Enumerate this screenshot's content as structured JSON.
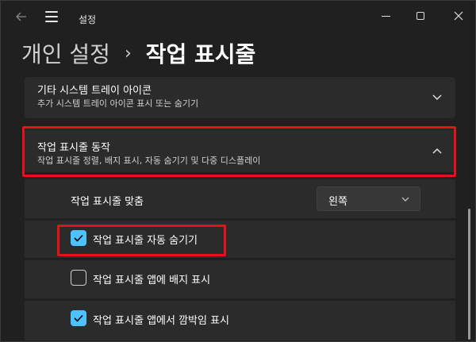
{
  "window": {
    "app_title": "설정",
    "controls": {
      "minimize": "minimize-icon",
      "maximize": "maximize-icon",
      "close": "close-icon"
    }
  },
  "breadcrumb": {
    "parent": "개인 설정",
    "separator": "›",
    "current": "작업 표시줄"
  },
  "sections": {
    "tray": {
      "title": "기타 시스템 트레이 아이콘",
      "description": "추가 시스템 트레이 아이콘 표시 또는 숨기기",
      "expanded": false
    },
    "behavior": {
      "title": "작업 표시줄 동작",
      "description": "작업 표시줄 정렬, 배지 표시, 자동 숨기기 및 다중 디스플레이",
      "expanded": true,
      "alignment": {
        "label": "작업 표시줄 맞춤",
        "value": "왼쪽"
      },
      "options": [
        {
          "label": "작업 표시줄 자동 숨기기",
          "checked": true
        },
        {
          "label": "작업 표시줄 앱에 배지 표시",
          "checked": false
        },
        {
          "label": "작업 표시줄 앱에서 깜박임 표시",
          "checked": true
        }
      ]
    }
  },
  "colors": {
    "accent": "#4cc2ff",
    "highlight": "#e8101a",
    "background": "#202020",
    "card": "#2b2b2b"
  }
}
